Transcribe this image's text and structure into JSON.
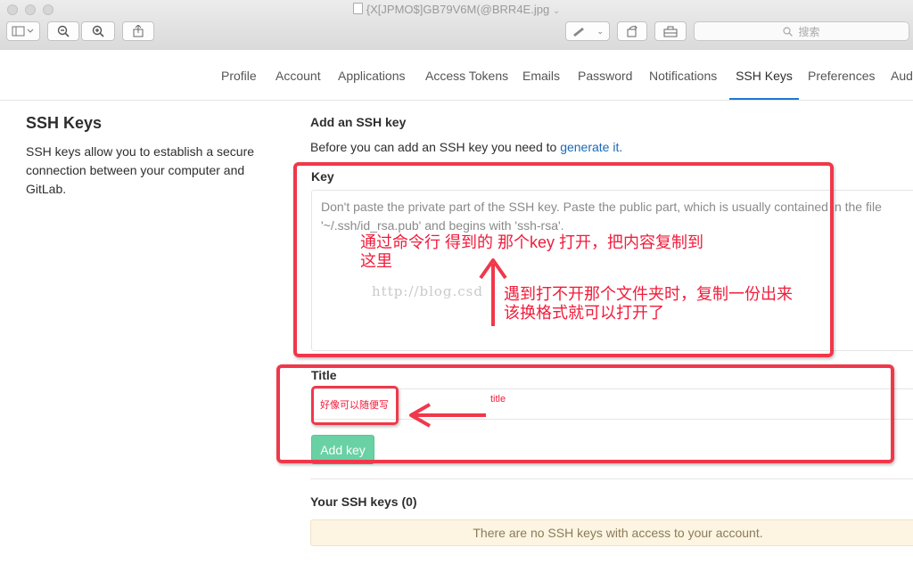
{
  "window": {
    "title": "{X[JPMO$]GB79V6M(@BRR4E.jpg",
    "search_placeholder": "搜索"
  },
  "nav": {
    "tabs": [
      "Profile",
      "Account",
      "Applications",
      "Access Tokens",
      "Emails",
      "Password",
      "Notifications",
      "SSH Keys",
      "Preferences",
      "Aud"
    ],
    "active": "SSH Keys"
  },
  "sidebar": {
    "title": "SSH Keys",
    "description": "SSH keys allow you to establish a secure connection between your computer and GitLab."
  },
  "form": {
    "heading": "Add an SSH key",
    "intro_text": "Before you can add an SSH key you need to ",
    "intro_link": "generate it.",
    "key_label": "Key",
    "key_placeholder": "Don't paste the private part of the SSH key. Paste the public part, which is usually contained in the file '~/.ssh/id_rsa.pub' and begins with 'ssh-rsa'.",
    "title_label": "Title",
    "title_value": "好像可以随便写",
    "submit_label": "Add key"
  },
  "keys_section": {
    "heading": "Your SSH keys (0)",
    "empty_notice": "There are no SSH keys with access to your account."
  },
  "annotations": {
    "note1_line1": "通过命令行 得到的 那个key  打开，把内容复制到",
    "note1_line2": "这里",
    "note2_line1": "遇到打不开那个文件夹时，复制一份出来",
    "note2_line2": "该换格式就可以打开了",
    "title_note": "title",
    "watermark": "http://blog.csd"
  },
  "colors": {
    "annotation_red": "#f0384a",
    "link_blue": "#1b69b6",
    "button_green": "#69d1a3",
    "active_tab_underline": "#1f78d1"
  }
}
